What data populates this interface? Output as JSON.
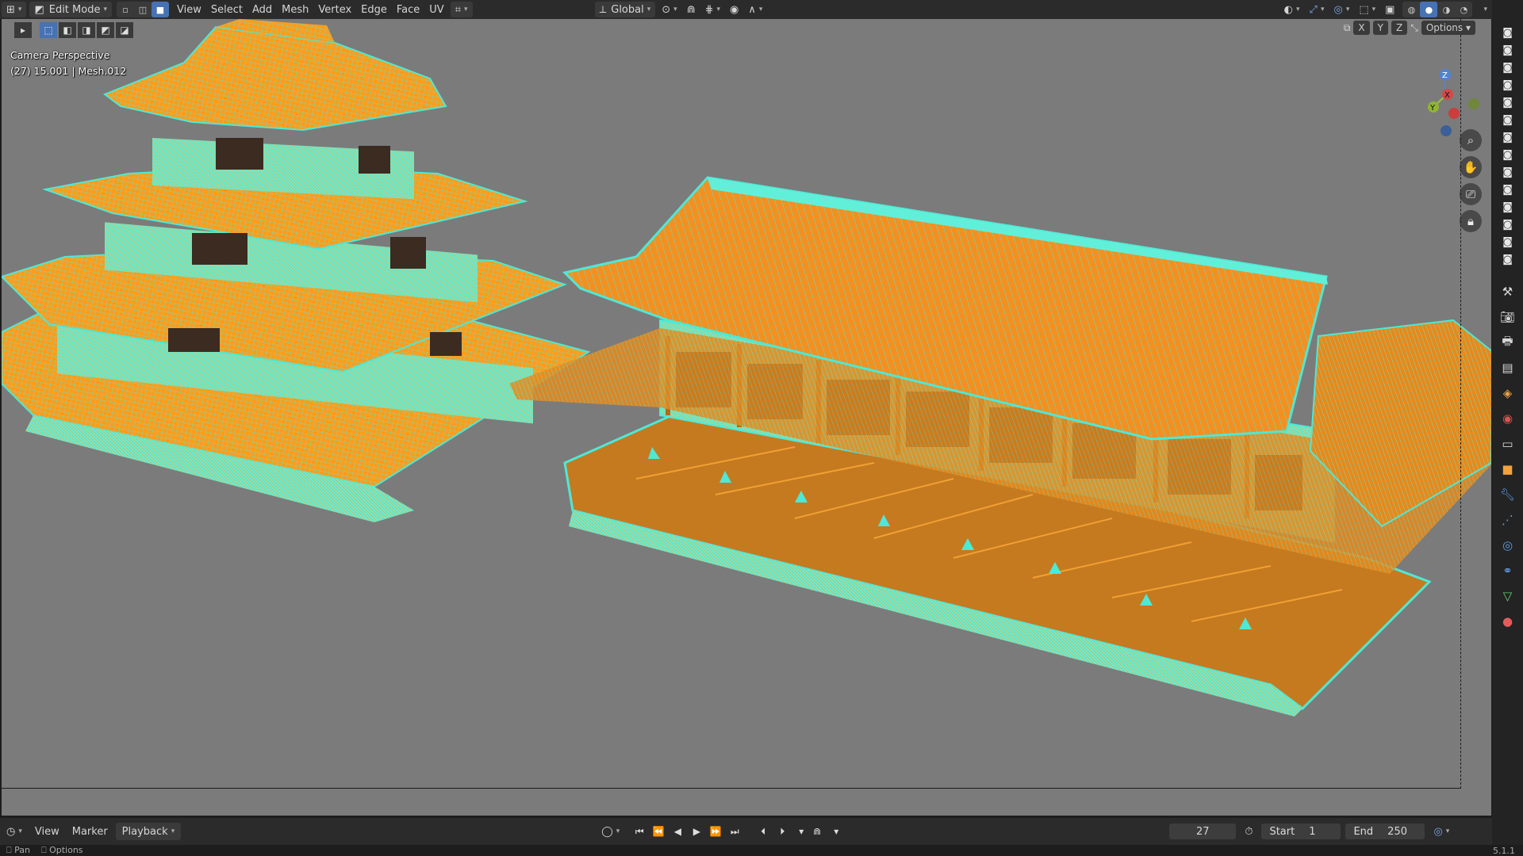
{
  "header": {
    "mode": "Edit Mode",
    "menus": [
      "View",
      "Select",
      "Add",
      "Mesh",
      "Vertex",
      "Edge",
      "Face",
      "UV"
    ],
    "orientation": "Global",
    "options_label": "Options",
    "axis_labels": [
      "X",
      "Y",
      "Z"
    ]
  },
  "viewport": {
    "camera_label": "Camera Perspective",
    "object_info": "(27) 15.001 | Mesh.012",
    "gizmo_axes": [
      "Z",
      "X",
      "Y"
    ],
    "colors": {
      "background": "#7b7b7b",
      "mesh_face": "#ff9c1a",
      "mesh_wire": "#4ee8d6"
    }
  },
  "timeline": {
    "menus": [
      "View",
      "Marker",
      "Playback"
    ],
    "current_frame": "27",
    "start_label": "Start",
    "start_value": "1",
    "end_label": "End",
    "end_value": "250"
  },
  "status": {
    "left1": "Pan",
    "left2": "Options",
    "version": "5.1.1"
  },
  "icons": {
    "editor_type": "editor-type-icon",
    "select_modes": [
      "vertex-select-icon",
      "edge-select-icon",
      "face-select-icon"
    ],
    "transport": [
      "jump-start-icon",
      "prev-key-icon",
      "play-reverse-icon",
      "play-icon",
      "next-key-icon",
      "jump-end-icon"
    ]
  }
}
